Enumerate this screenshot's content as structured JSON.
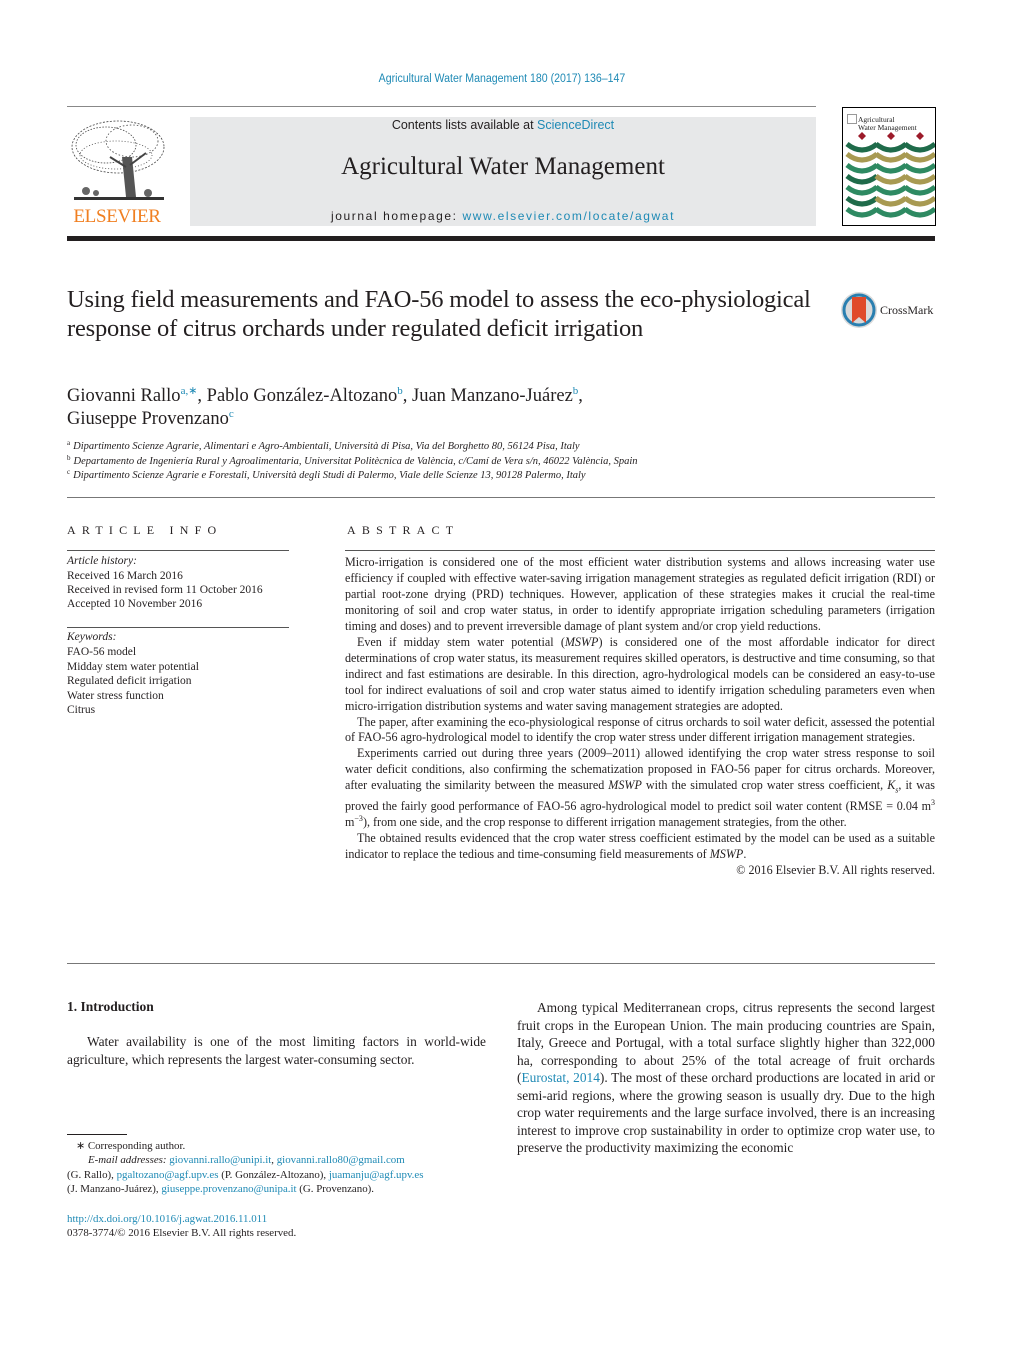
{
  "header": {
    "citation": "Agricultural Water Management 180 (2017) 136–147",
    "contents_prefix": "Contents lists available at ",
    "contents_link": "ScienceDirect",
    "journal_name": "Agricultural Water Management",
    "homepage_prefix": "journal homepage: ",
    "homepage_link": "www.elsevier.com/locate/agwat",
    "publisher_logo_text": "ELSEVIER",
    "cover_title_line1": "Agricultural",
    "cover_title_line2": "Water Management",
    "brand_color": "#f07f21",
    "link_color": "#1f8ab5"
  },
  "article": {
    "title": "Using field measurements and FAO-56 model to assess the eco-physiological response of citrus orchards under regulated deficit irrigation",
    "crossmark_label": "CrossMark",
    "authors": [
      {
        "name": "Giovanni Rallo",
        "sup": "a,∗",
        "sep": ", "
      },
      {
        "name": "Pablo González-Altozano",
        "sup": "b",
        "sep": ", "
      },
      {
        "name": "Juan Manzano-Juárez",
        "sup": "b",
        "sep": ","
      },
      {
        "name": "Giuseppe Provenzano",
        "sup": "c",
        "sep": ""
      }
    ],
    "affiliations": [
      {
        "key": "a",
        "text": "Dipartimento Scienze Agrarie, Alimentari e Agro-Ambientali, Università di Pisa, Via del Borghetto 80, 56124 Pisa, Italy"
      },
      {
        "key": "b",
        "text": "Departamento de Ingeniería Rural y Agroalimentaria, Universitat Politècnica de València, c/Camí de Vera s/n, 46022 València, Spain"
      },
      {
        "key": "c",
        "text": "Dipartimento Scienze Agrarie e Forestali, Università degli Studi di Palermo, Viale delle Scienze 13, 90128 Palermo, Italy"
      }
    ]
  },
  "article_info": {
    "heading": "ARTICLE INFO",
    "history_label": "Article history:",
    "history": [
      "Received 16 March 2016",
      "Received in revised form 11 October 2016",
      "Accepted 10 November 2016"
    ],
    "keywords_label": "Keywords:",
    "keywords": [
      "FAO-56 model",
      "Midday stem water potential",
      "Regulated deficit irrigation",
      "Water stress function",
      "Citrus"
    ]
  },
  "abstract": {
    "heading": "ABSTRACT",
    "p1": "Micro-irrigation is considered one of the most efficient water distribution systems and allows increasing water use efficiency if coupled with effective water-saving irrigation management strategies as regulated deficit irrigation (RDI) or partial root-zone drying (PRD) techniques. However, application of these strategies makes it crucial the real-time monitoring of soil and crop water status, in order to identify appropriate irrigation scheduling parameters (irrigation timing and doses) and to prevent irreversible damage of plant system and/or crop yield reductions.",
    "p2_a": "Even if midday stem water potential (",
    "p2_em": "MSWP",
    "p2_b": ") is considered one of the most affordable indicator for direct determinations of crop water status, its measurement requires skilled operators, is destructive and time consuming, so that indirect and fast estimations are desirable. In this direction, agro-hydrological models can be considered an easy-to-use tool for indirect evaluations of soil and crop water status aimed to identify irrigation scheduling parameters even when micro-irrigation distribution systems and water saving management strategies are adopted.",
    "p3": "The paper, after examining the eco-physiological response of citrus orchards to soil water deficit, assessed the potential of FAO-56 agro-hydrological model to identify the crop water stress under different irrigation management strategies.",
    "p4_a": "Experiments carried out during three years (2009–2011) allowed identifying the crop water stress response to soil water deficit conditions, also confirming the schematization proposed in FAO-56 paper for citrus orchards. Moreover, after evaluating the similarity between the measured ",
    "p4_em1": "MSWP",
    "p4_b": " with the simulated crop water stress coefficient, ",
    "p4_ks": "K",
    "p4_ks_sub": "s",
    "p4_c": ", it was proved the fairly good performance of FAO-56 agro-hydrological model to predict soil water content (RMSE = 0.04 m",
    "p4_sup1": "3",
    "p4_d": " m",
    "p4_sup2": "−3",
    "p4_e": "), from one side, and the crop response to different irrigation management strategies, from the other.",
    "p5_a": "The obtained results evidenced that the crop water stress coefficient estimated by the model can be used as a suitable indicator to replace the tedious and time-consuming field measurements of ",
    "p5_em": "MSWP",
    "p5_b": ".",
    "copyright": "© 2016 Elsevier B.V. All rights reserved."
  },
  "body": {
    "section_heading": "1.  Introduction",
    "left_para": "Water availability is one of the most limiting factors in world-wide agriculture, which represents the largest water-consuming sector.",
    "right_para_a": "Among typical Mediterranean crops, citrus represents the second largest fruit crops in the European Union. The main producing countries are Spain, Italy, Greece and Portugal, with a total surface slightly higher than 322,000 ha, corresponding to about 25% of the total acreage of fruit orchards (",
    "right_para_link": "Eurostat, 2014",
    "right_para_b": "). The most of these orchard productions are located in arid or semi-arid regions, where the growing season is usually dry. Due to the high crop water requirements and the large surface involved, there is an increasing interest to improve crop sustainability in order to optimize crop water use, to preserve the productivity maximizing the economic"
  },
  "footnote": {
    "corresponding": "∗  Corresponding author.",
    "email_label": "E-mail addresses:",
    "email1": "giovanni.rallo@unipi.it",
    "email2": "giovanni.rallo80@gmail.com",
    "name1": "(G. Rallo), ",
    "email3": "pgaltozano@agf.upv.es",
    "name2": " (P. González-Altozano), ",
    "email4": "juamanju@agf.upv.es",
    "name3": "(J. Manzano-Juárez), ",
    "email5": "giuseppe.provenzano@unipa.it",
    "name4": " (G. Provenzano).",
    "doi": "http://dx.doi.org/10.1016/j.agwat.2016.11.011",
    "issn": "0378-3774/© 2016 Elsevier B.V. All rights reserved."
  }
}
